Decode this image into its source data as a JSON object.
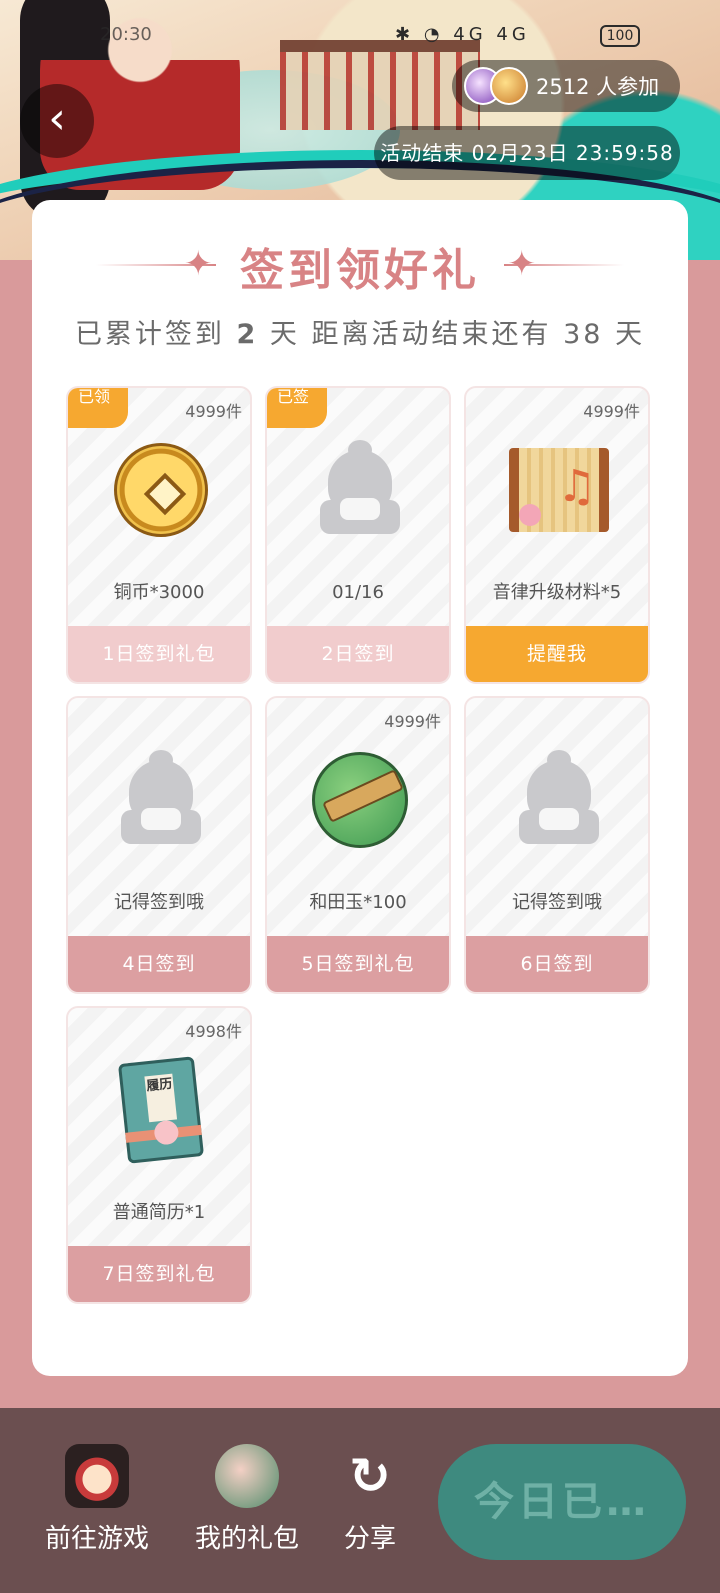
{
  "status_bar": {
    "clock": "20:30",
    "signal": "4G 4G",
    "battery": "100"
  },
  "header": {
    "participants_count": "2512 人参加",
    "end_time": "活动结束 02月23日 23:59:58"
  },
  "card": {
    "title": "签到领好礼",
    "subtitle_prefix": "已累计签到",
    "days_signed": "2",
    "subtitle_middle": "天  距离活动结束还有",
    "days_left": "38",
    "subtitle_suffix": "天"
  },
  "rewards": [
    {
      "stock": "4999件",
      "tag": "已领",
      "icon": "copper-coin-icon",
      "name": "铜币*3000",
      "footer": "1日签到礼包",
      "state": "claimed"
    },
    {
      "stock": "",
      "tag": "已签",
      "icon": "placeholder-avatar-icon",
      "name": "01/16",
      "footer": "2日签到",
      "state": "claimed"
    },
    {
      "stock": "4999件",
      "tag": "",
      "icon": "music-scroll-icon",
      "name": "音律升级材料*5",
      "footer": "提醒我",
      "state": "remind"
    },
    {
      "stock": "",
      "tag": "",
      "icon": "placeholder-avatar-icon",
      "name": "记得签到哦",
      "footer": "4日签到",
      "state": "locked"
    },
    {
      "stock": "4999件",
      "tag": "",
      "icon": "jade-icon",
      "name": "和田玉*100",
      "footer": "5日签到礼包",
      "state": "locked"
    },
    {
      "stock": "",
      "tag": "",
      "icon": "placeholder-avatar-icon",
      "name": "记得签到哦",
      "footer": "6日签到",
      "state": "locked"
    },
    {
      "stock": "4998件",
      "tag": "",
      "icon": "resume-book-icon",
      "name": "普通简历*1",
      "footer": "7日签到礼包",
      "state": "locked"
    }
  ],
  "resume_label": "履历",
  "bottom_bar": {
    "game_label": "前往游戏",
    "gift_label": "我的礼包",
    "share_label": "分享",
    "today_button": "今日已…"
  },
  "colors": {
    "page_bg": "#d99a9b",
    "accent_pink": "#d88385",
    "button_orange": "#f6a830",
    "bottom_bar": "#6b4f50",
    "today_button": "#3e8a7f"
  }
}
